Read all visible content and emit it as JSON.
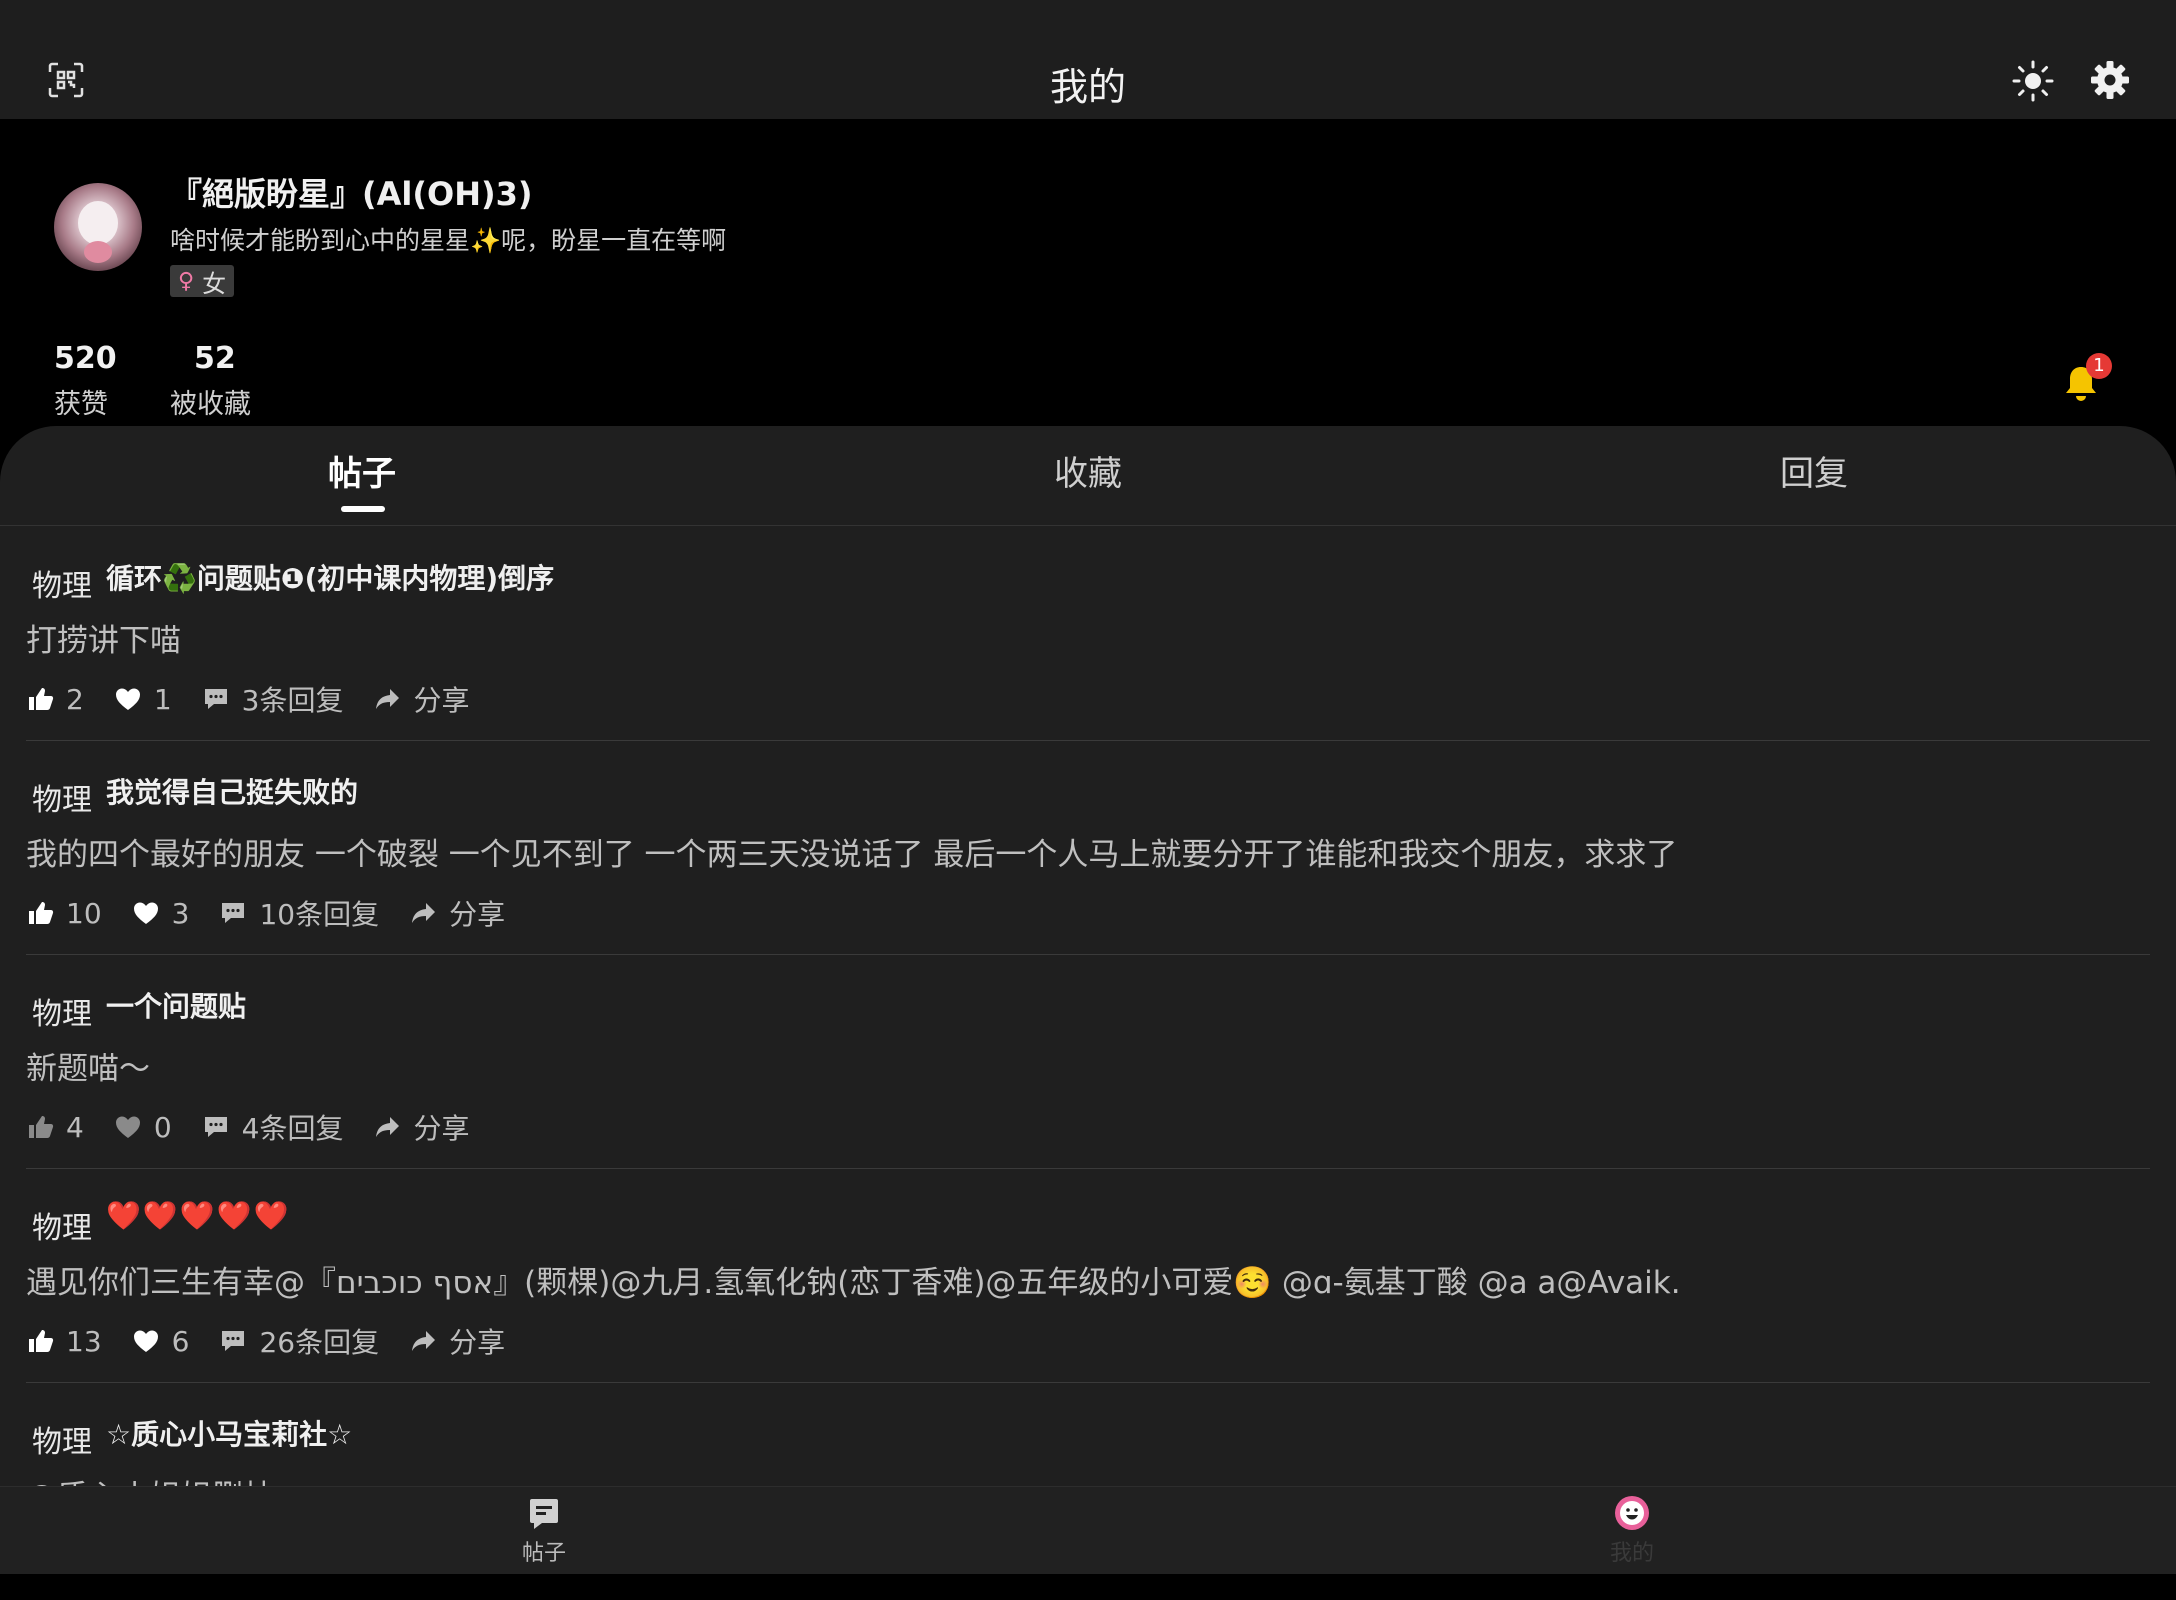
{
  "header": {
    "title": "我的",
    "icons": {
      "left": "qr-scan-icon",
      "theme": "sun-icon",
      "settings": "gear-icon"
    }
  },
  "profile": {
    "username": "『絕版盼星』(Al(OH)3)",
    "bio": "啥时候才能盼到心中的星星✨呢，盼星一直在等啊",
    "gender_symbol": "♀",
    "gender": "女",
    "likes_count": "520",
    "likes_label": "获赞",
    "favorited_count": "52",
    "favorited_label": "被收藏",
    "notification_count": "1"
  },
  "tabs": [
    {
      "label": "帖子",
      "active": true
    },
    {
      "label": "收藏",
      "active": false
    },
    {
      "label": "回复",
      "active": false
    }
  ],
  "posts": [
    {
      "category": "物理",
      "title": "循环♻️问题贴❶(初中课内物理)倒序",
      "body": "打捞讲下喵",
      "likes": "2",
      "hearts": "1",
      "replies": "3条回复",
      "share": "分享",
      "active": true
    },
    {
      "category": "物理",
      "title": "我觉得自己挺失败的",
      "body": "我的四个最好的朋友 一个破裂 一个见不到了 一个两三天没说话了 最后一个人马上就要分开了谁能和我交个朋友，求求了",
      "likes": "10",
      "hearts": "3",
      "replies": "10条回复",
      "share": "分享",
      "active": true
    },
    {
      "category": "物理",
      "title": "一个问题贴",
      "body": "新题喵～",
      "likes": "4",
      "hearts": "0",
      "replies": "4条回复",
      "share": "分享",
      "active": false
    },
    {
      "category": "物理",
      "title": "❤️❤️❤️❤️❤️",
      "body": "遇见你们三生有幸@『אסף כוכבים』(颗棵)@九月.氢氧化钠(恋丁香难)@五年级的小可爱☺️ @ɑ-氨基丁酸 @a a@Avaik.",
      "likes": "13",
      "hearts": "6",
      "replies": "26条回复",
      "share": "分享",
      "active": true
    },
    {
      "category": "物理",
      "title": "☆质心小马宝莉社☆",
      "body": "@质心小姐姐删帖",
      "likes": "",
      "hearts": "",
      "replies": "",
      "share": "",
      "active": true
    }
  ],
  "bottom_nav": [
    {
      "label": "帖子",
      "icon": "post-icon"
    },
    {
      "label": "我的",
      "icon": "smiley-avatar-icon"
    }
  ],
  "colors": {
    "accent_badge": "#e53935",
    "bell": "#f5c400",
    "panel": "#1f1f1f",
    "topbar": "#1e1e1e"
  }
}
